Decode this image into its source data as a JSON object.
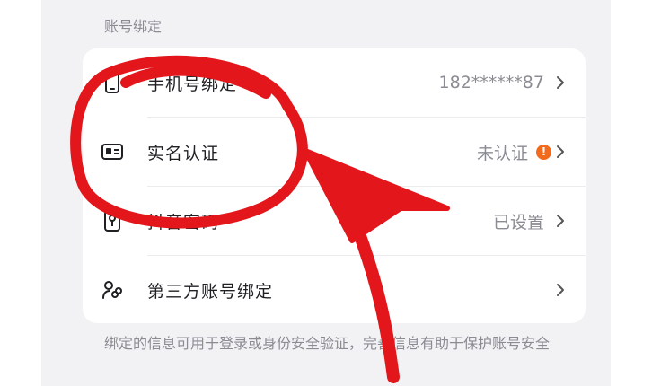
{
  "section": {
    "title": "账号绑定"
  },
  "rows": [
    {
      "label": "手机号绑定",
      "value": "182******87",
      "icon": "phone-icon"
    },
    {
      "label": "实名认证",
      "value": "未认证",
      "icon": "id-card-icon",
      "warning": "!"
    },
    {
      "label": "抖音密码",
      "value": "已设置",
      "icon": "key-icon"
    },
    {
      "label": "第三方账号绑定",
      "value": "",
      "icon": "link-icon"
    }
  ],
  "footnote": "绑定的信息可用于登录或身份安全验证，完善信息有助于保护账号安全",
  "colors": {
    "page_bg": "#f2f2f4",
    "card_bg": "#ffffff",
    "muted_text": "#8b8b93",
    "warning": "#f26a1b",
    "annotation_red": "#e2161b"
  }
}
